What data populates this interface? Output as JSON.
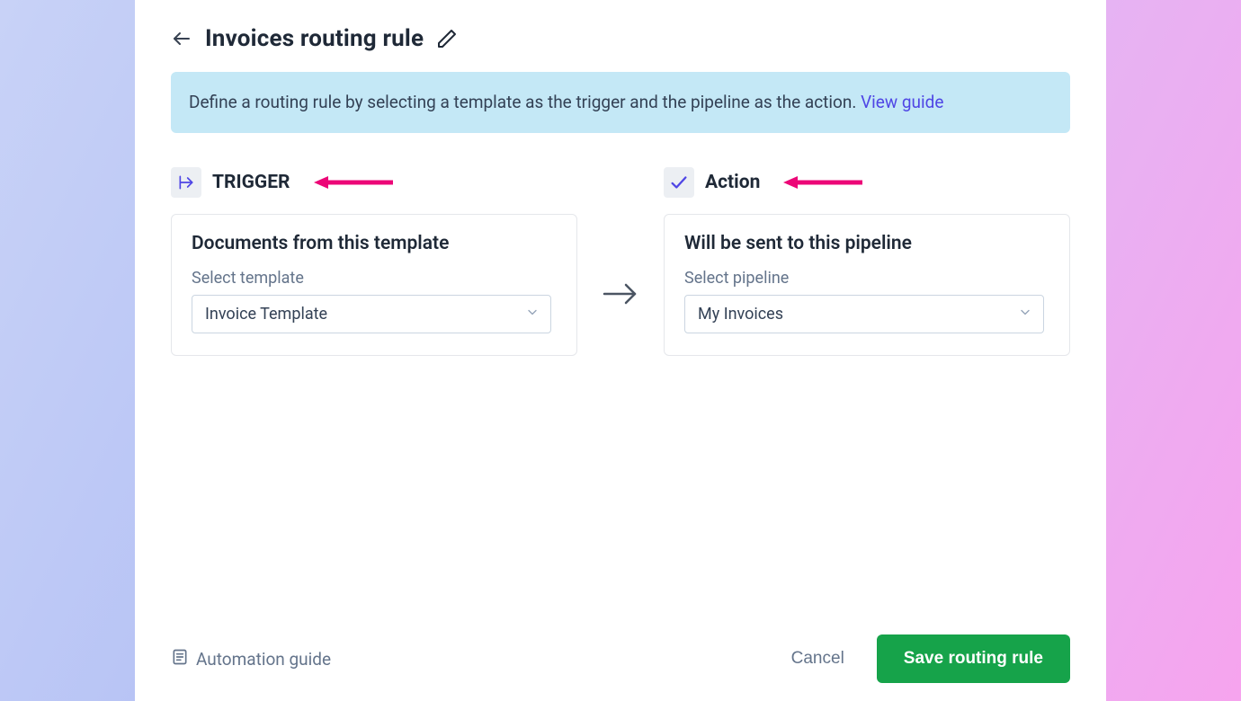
{
  "page": {
    "title": "Invoices routing rule"
  },
  "banner": {
    "text": "Define a routing rule by selecting a template as the trigger and the pipeline as the action.",
    "link_label": "View guide"
  },
  "trigger": {
    "section_label": "TRIGGER",
    "card_title": "Documents from this template",
    "field_label": "Select template",
    "selected": "Invoice Template"
  },
  "action": {
    "section_label": "Action",
    "card_title": "Will be sent to this pipeline",
    "field_label": "Select pipeline",
    "selected": "My Invoices"
  },
  "footer": {
    "guide_label": "Automation guide",
    "cancel_label": "Cancel",
    "save_label": "Save routing rule"
  },
  "colors": {
    "annotation_arrow": "#ec0677",
    "save_button": "#16a34a",
    "banner_bg": "#c4e8f6",
    "link": "#4f46e5"
  }
}
